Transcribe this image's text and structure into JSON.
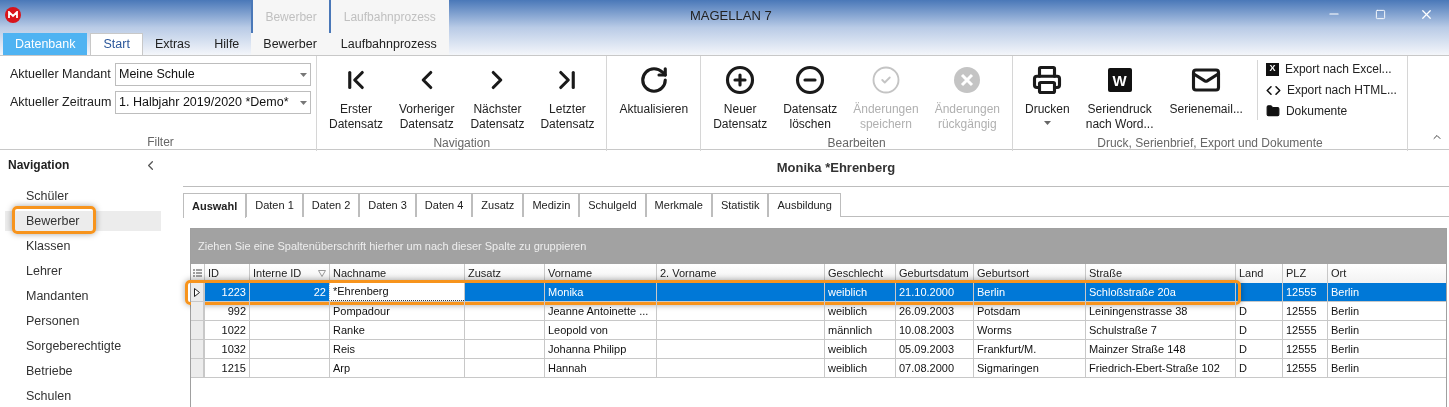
{
  "window": {
    "title": "MAGELLAN 7"
  },
  "ribbon_tabs": [
    {
      "label": "Datenbank",
      "kind": "file",
      "selected": false
    },
    {
      "label": "Start",
      "kind": "tab",
      "selected": true
    },
    {
      "label": "Extras",
      "kind": "tab",
      "selected": false
    },
    {
      "label": "Hilfe",
      "kind": "tab",
      "selected": false
    },
    {
      "label": "Bewerber",
      "kind": "context",
      "context_label": "Bewerber",
      "selected": false
    },
    {
      "label": "Laufbahnprozess",
      "kind": "context",
      "context_label": "Laufbahnprozess",
      "selected": false
    }
  ],
  "filter": {
    "label": "Filter",
    "fields": [
      {
        "label": "Aktueller Mandant",
        "value": "Meine Schule"
      },
      {
        "label": "Aktueller Zeitraum",
        "value": "1. Halbjahr 2019/2020 *Demo*"
      }
    ]
  },
  "groups": [
    {
      "label": "Navigation",
      "buttons": [
        {
          "kind": "first",
          "lines": [
            "Erster",
            "Datensatz"
          ],
          "disabled": false
        },
        {
          "kind": "prev",
          "lines": [
            "Vorheriger",
            "Datensatz"
          ],
          "disabled": false
        },
        {
          "kind": "next",
          "lines": [
            "Nächster",
            "Datensatz"
          ],
          "disabled": false
        },
        {
          "kind": "last",
          "lines": [
            "Letzter",
            "Datensatz"
          ],
          "disabled": false
        }
      ]
    },
    {
      "buttons": [
        {
          "kind": "refresh",
          "lines": [
            "Aktualisieren"
          ],
          "disabled": false
        }
      ]
    },
    {
      "label": "Bearbeiten",
      "buttons": [
        {
          "kind": "plus",
          "lines": [
            "Neuer",
            "Datensatz"
          ],
          "disabled": false
        },
        {
          "kind": "minus",
          "lines": [
            "Datensatz",
            "löschen"
          ],
          "disabled": false
        },
        {
          "kind": "check",
          "lines": [
            "Änderungen",
            "speichern"
          ],
          "disabled": true
        },
        {
          "kind": "cancel",
          "lines": [
            "Änderungen",
            "rückgängig"
          ],
          "disabled": true
        }
      ]
    },
    {
      "label": "Druck, Serienbrief, Export und Dokumente",
      "buttons": [
        {
          "kind": "print",
          "lines": [
            "Drucken"
          ],
          "disabled": false,
          "dropdown": true
        },
        {
          "kind": "word",
          "icon_text": "W",
          "lines": [
            "Seriendruck",
            "nach Word..."
          ],
          "disabled": false
        },
        {
          "kind": "mail",
          "lines": [
            "Serienemail..."
          ],
          "disabled": false
        }
      ],
      "small_buttons": [
        {
          "kind": "excel",
          "icon_text": "X",
          "label": "Export nach Excel..."
        },
        {
          "kind": "code",
          "label": "Export nach HTML..."
        },
        {
          "kind": "folder",
          "label": "Dokumente"
        }
      ]
    }
  ],
  "navigation": {
    "title": "Navigation",
    "items": [
      {
        "label": "Schüler",
        "selected": false,
        "highlighted": false
      },
      {
        "label": "Bewerber",
        "selected": true,
        "highlighted": true
      },
      {
        "label": "Klassen",
        "selected": false,
        "highlighted": false
      },
      {
        "label": "Lehrer",
        "selected": false,
        "highlighted": false
      },
      {
        "label": "Mandanten",
        "selected": false,
        "highlighted": false
      },
      {
        "label": "Personen",
        "selected": false,
        "highlighted": false
      },
      {
        "label": "Sorgeberechtigte",
        "selected": false,
        "highlighted": false
      },
      {
        "label": "Betriebe",
        "selected": false,
        "highlighted": false
      },
      {
        "label": "Schulen",
        "selected": false,
        "highlighted": false
      }
    ]
  },
  "record_title": "Monika *Ehrenberg",
  "record_tabs": [
    {
      "label": "Auswahl",
      "selected": true
    },
    {
      "label": "Daten 1",
      "selected": false
    },
    {
      "label": "Daten 2",
      "selected": false
    },
    {
      "label": "Daten 3",
      "selected": false
    },
    {
      "label": "Daten 4",
      "selected": false
    },
    {
      "label": "Zusatz",
      "selected": false
    },
    {
      "label": "Medizin",
      "selected": false
    },
    {
      "label": "Schulgeld",
      "selected": false
    },
    {
      "label": "Merkmale",
      "selected": false
    },
    {
      "label": "Statistik",
      "selected": false
    },
    {
      "label": "Ausbildung",
      "selected": false
    }
  ],
  "grid": {
    "group_hint": "Ziehen Sie eine Spaltenüberschrift hierher um nach dieser Spalte zu gruppieren",
    "columns": [
      {
        "label": "ID"
      },
      {
        "label": "Interne ID",
        "filter": true
      },
      {
        "label": "Nachname",
        "focused": true
      },
      {
        "label": "Zusatz"
      },
      {
        "label": "Vorname"
      },
      {
        "label": "2. Vorname"
      },
      {
        "label": "Geschlecht"
      },
      {
        "label": "Geburtsdatum"
      },
      {
        "label": "Geburtsort"
      },
      {
        "label": "Straße"
      },
      {
        "label": "Land"
      },
      {
        "label": "PLZ"
      },
      {
        "label": "Ort"
      }
    ],
    "rows": [
      {
        "selected": true,
        "highlighted": true,
        "cells": [
          "1223",
          "22",
          "*Ehrenberg",
          "",
          "Monika",
          "",
          "weiblich",
          "21.10.2000",
          "Berlin",
          "Schloßstraße 20a",
          "",
          "12555",
          "Berlin"
        ]
      },
      {
        "selected": false,
        "highlighted": false,
        "cells": [
          "992",
          "",
          "Pompadour",
          "",
          "Jeanne Antoinette ...",
          "",
          "weiblich",
          "26.09.2003",
          "Potsdam",
          "Leiningenstrasse 38",
          "D",
          "12555",
          "Berlin"
        ]
      },
      {
        "selected": false,
        "highlighted": false,
        "cells": [
          "1022",
          "",
          "Ranke",
          "",
          "Leopold von",
          "",
          "männlich",
          "10.08.2003",
          "Worms",
          "Schulstraße 7",
          "D",
          "12555",
          "Berlin"
        ]
      },
      {
        "selected": false,
        "highlighted": false,
        "cells": [
          "1032",
          "",
          "Reis",
          "",
          "Johanna Philipp",
          "",
          "weiblich",
          "05.09.2003",
          "Frankfurt/M.",
          "Mainzer Straße 148",
          "D",
          "12555",
          "Berlin"
        ]
      },
      {
        "selected": false,
        "highlighted": false,
        "cells": [
          "1215",
          "",
          "Arp",
          "",
          "Hannah",
          "",
          "weiblich",
          "07.08.2000",
          "Sigmaringen",
          "Friedrich-Ebert-Straße 102",
          "D",
          "12555",
          "Berlin"
        ]
      }
    ]
  }
}
